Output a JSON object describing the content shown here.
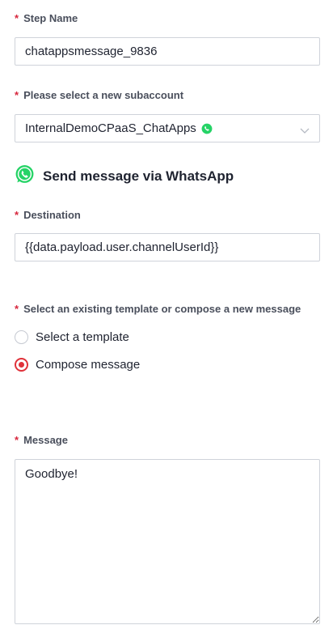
{
  "step_name": {
    "label": "Step Name",
    "value": "chatappsmessage_9836"
  },
  "subaccount": {
    "label": "Please select a new subaccount",
    "value": "InternalDemoCPaaS_ChatApps"
  },
  "section": {
    "title": "Send message via WhatsApp"
  },
  "destination": {
    "label": "Destination",
    "value": "{{data.payload.user.channelUserId}}"
  },
  "template_choice": {
    "label": "Select an existing template or compose a new message",
    "options": [
      {
        "label": "Select a template",
        "selected": false
      },
      {
        "label": "Compose message",
        "selected": true
      }
    ]
  },
  "message": {
    "label": "Message",
    "value": "Goodbye!"
  },
  "required_marker": "*",
  "colors": {
    "required": "#d7263d",
    "radio_accent": "#e0323a",
    "whatsapp": "#25d366"
  }
}
